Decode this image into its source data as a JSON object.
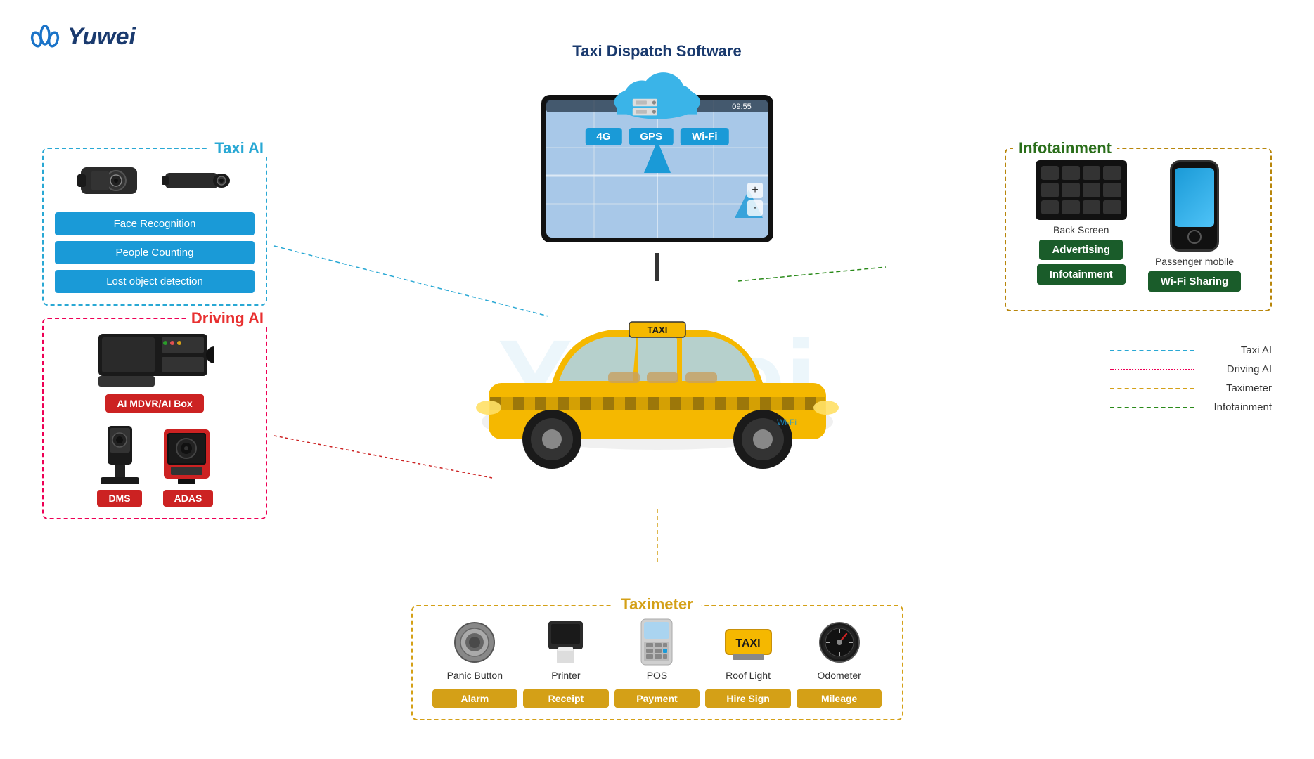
{
  "logo": {
    "text": "Yuwei",
    "icon": "W"
  },
  "dispatch": {
    "title": "Taxi Dispatch Software",
    "badges": [
      "4G",
      "GPS",
      "Wi-Fi"
    ]
  },
  "taxiAI": {
    "title": "Taxi AI",
    "features": [
      "Face Recognition",
      "People Counting",
      "Lost object detection"
    ]
  },
  "drivingAI": {
    "title": "Driving AI",
    "mdvrLabel": "AI MDVR/AI Box",
    "devices": [
      "DMS",
      "ADAS"
    ]
  },
  "infotainment": {
    "title": "Infotainment",
    "devices": [
      "Back Screen",
      "Passenger mobile"
    ],
    "badges": [
      "Advertising",
      "Wi-Fi Sharing",
      "Infotainment"
    ]
  },
  "taximeter": {
    "title": "Taximeter",
    "devices": [
      {
        "name": "Panic Button",
        "label": "Alarm"
      },
      {
        "name": "Printer",
        "label": "Receipt"
      },
      {
        "name": "POS",
        "label": "Payment"
      },
      {
        "name": "Roof Light",
        "label": "Hire Sign"
      },
      {
        "name": "Odometer",
        "label": "Mileage"
      }
    ]
  },
  "legend": {
    "items": [
      {
        "label": "Taxi AI",
        "style": "cyan-dashed"
      },
      {
        "label": "Driving AI",
        "style": "red-dotted"
      },
      {
        "label": "Taximeter",
        "style": "yellow-dashed"
      },
      {
        "label": "Infotainment",
        "style": "green-dashed"
      }
    ]
  }
}
